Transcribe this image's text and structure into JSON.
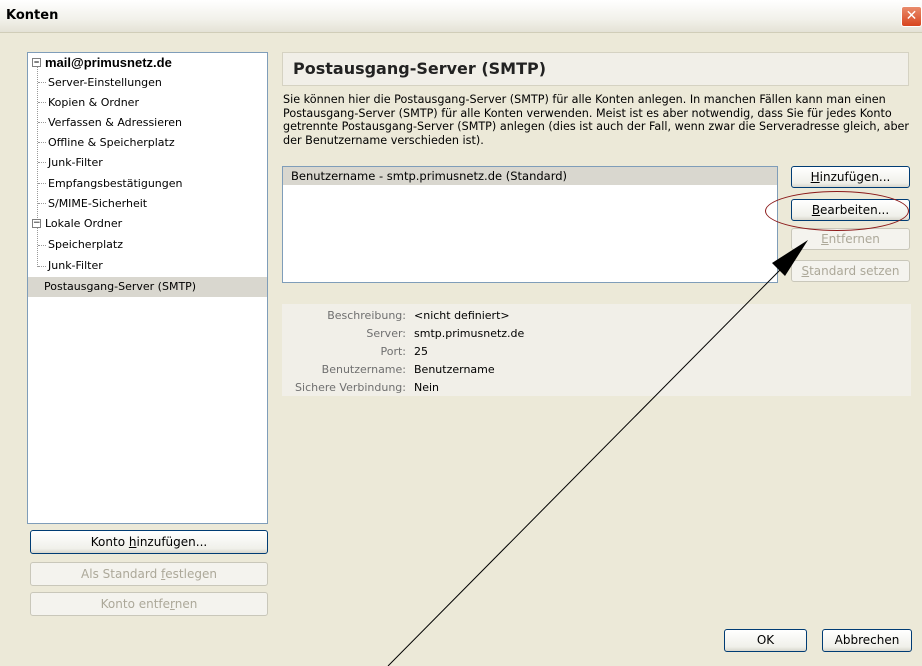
{
  "window": {
    "title": "Konten",
    "close_symbol": "✕"
  },
  "tree": {
    "accounts": [
      {
        "label": "mail@primusnetz.de",
        "children": [
          "Server-Einstellungen",
          "Kopien & Ordner",
          "Verfassen & Adressieren",
          "Offline & Speicherplatz",
          "Junk-Filter",
          "Empfangsbestätigungen",
          "S/MIME-Sicherheit"
        ]
      },
      {
        "label": "Lokale Ordner",
        "children": [
          "Speicherplatz",
          "Junk-Filter"
        ]
      }
    ],
    "smtp_item": "Postausgang-Server (SMTP)",
    "expander_symbol": "−"
  },
  "left_buttons": {
    "add_account": {
      "before": "Konto ",
      "key": "h",
      "after": "inzufügen..."
    },
    "set_default": {
      "before": "Als Standard ",
      "key": "f",
      "after": "estlegen"
    },
    "remove_account": {
      "before": "Konto entfe",
      "key": "r",
      "after": "nen"
    }
  },
  "panel": {
    "title": "Postausgang-Server (SMTP)",
    "description": "Sie können hier die Postausgang-Server (SMTP) für alle Konten anlegen. In manchen Fällen kann man einen Postausgang-Server (SMTP) für alle Konten verwenden. Meist ist es aber notwendig, dass Sie für jedes Konto getrennte Postausgang-Server (SMTP) anlegen (dies ist auch der Fall, wenn zwar die Serveradresse gleich, aber der Benutzername verschieden ist).",
    "servers": [
      "Benutzername - smtp.primusnetz.de (Standard)"
    ]
  },
  "server_buttons": {
    "add": {
      "before": "",
      "key": "H",
      "after": "inzufügen..."
    },
    "edit": {
      "before": "",
      "key": "B",
      "after": "earbeiten..."
    },
    "remove": {
      "before": "",
      "key": "E",
      "after": "ntfernen"
    },
    "set_default": {
      "before": "",
      "key": "S",
      "after": "tandard setzen"
    }
  },
  "details": [
    {
      "label": "Beschreibung:",
      "value": "<nicht definiert>"
    },
    {
      "label": "Server:",
      "value": "smtp.primusnetz.de"
    },
    {
      "label": "Port:",
      "value": "25"
    },
    {
      "label": "Benutzername:",
      "value": "Benutzername"
    },
    {
      "label": "Sichere Verbindung:",
      "value": "Nein"
    }
  ],
  "footer": {
    "ok": "OK",
    "cancel": "Abbrechen"
  }
}
